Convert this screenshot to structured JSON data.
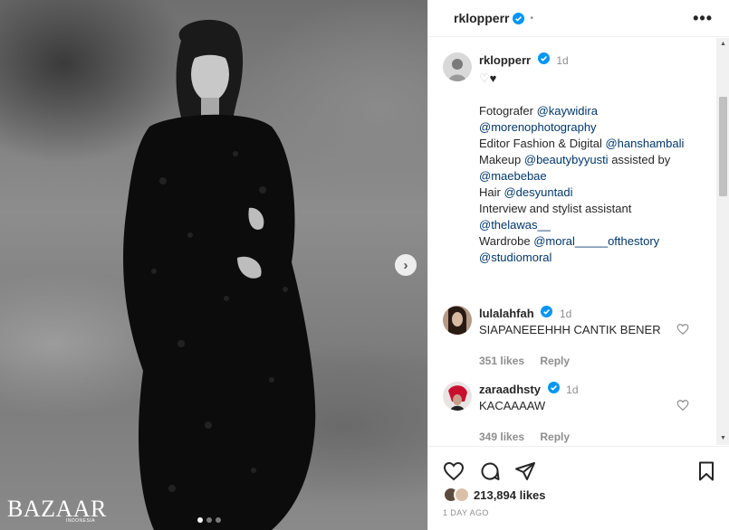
{
  "post": {
    "brand_logo": "BAZAAR",
    "brand_sub": "INDONESIA",
    "carousel": {
      "total": 3,
      "current": 1
    },
    "next_icon": "chevron-right-icon"
  },
  "header": {
    "username": "rklopperr",
    "verified_icon": "verified-badge-icon",
    "separator": "•",
    "more_icon": "more-options-icon"
  },
  "caption": {
    "username": "rklopperr",
    "time": "1d",
    "lines": [
      {
        "text": "Fotografer ",
        "mention": "@kaywidira"
      },
      {
        "text": "",
        "mention": "@morenophotography"
      },
      {
        "text": "Editor Fashion & Digital ",
        "mention": "@hanshambali"
      },
      {
        "text": "Makeup ",
        "mention": "@beautybyyusti",
        "tail": " assisted by"
      },
      {
        "text": "",
        "mention": "@maebebae"
      },
      {
        "text": "Hair ",
        "mention": "@desyuntadi"
      },
      {
        "text": "Interview and stylist assistant",
        "mention": ""
      },
      {
        "text": "",
        "mention": "@thelawas__"
      },
      {
        "text": "Wardrobe ",
        "mention": "@moral_____ofthestory"
      },
      {
        "text": "",
        "mention": "@studiomoral"
      }
    ]
  },
  "comments": [
    {
      "username": "lulalahfah",
      "time": "1d",
      "text": "SIAPANEEEHHH CANTIK BENER",
      "likes": "351 likes",
      "reply": "Reply"
    },
    {
      "username": "zaraadhsty",
      "time": "1d",
      "text": "KACAAAAW",
      "likes": "349 likes",
      "reply": "Reply"
    }
  ],
  "actions": {
    "like_icon": "heart-icon",
    "comment_icon": "comment-icon",
    "share_icon": "share-icon",
    "save_icon": "bookmark-icon",
    "likes_count": "213,894 likes",
    "date": "1 DAY AGO"
  },
  "colors": {
    "mention": "#00376b",
    "verified": "#0095f6",
    "muted": "#8e8e8e"
  }
}
